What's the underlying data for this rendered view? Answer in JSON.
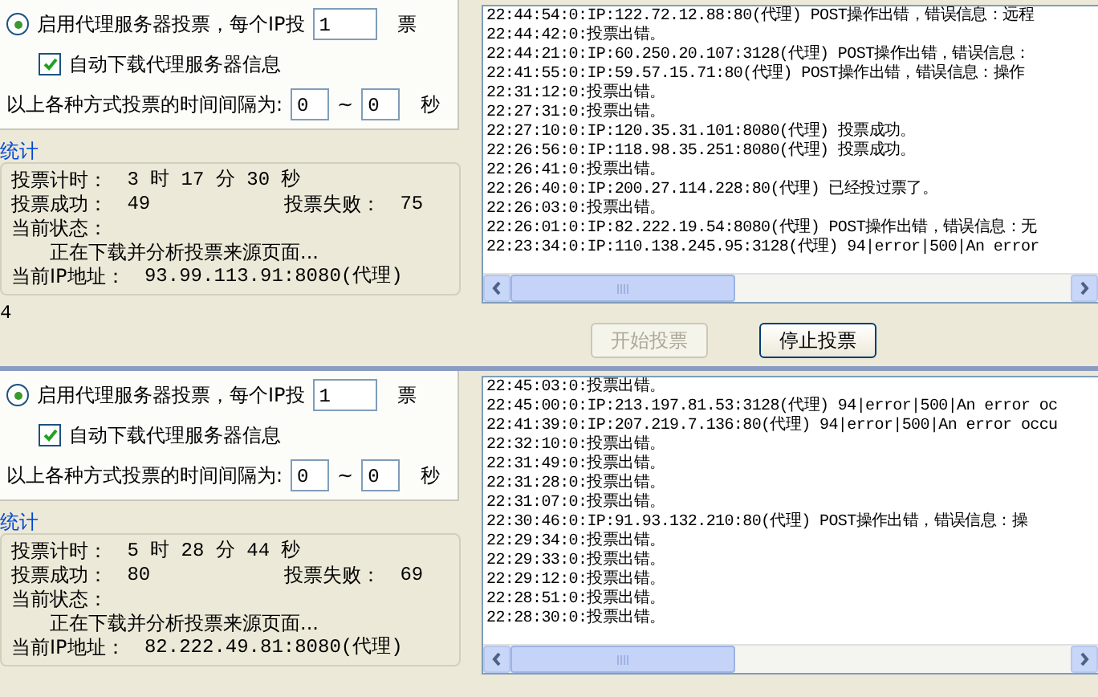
{
  "panels": [
    {
      "proxy_option": {
        "label": "启用代理服务器投票，每个IP投",
        "selected": true,
        "value": "1",
        "unit": "票"
      },
      "auto_download": {
        "label": "自动下载代理服务器信息",
        "checked": true
      },
      "interval": {
        "label": "以上各种方式投票的时间间隔为:",
        "from": "0",
        "separator": "~",
        "to": "0",
        "unit": "秒"
      },
      "stats": {
        "title": "统计",
        "timer_label": "投票计时：",
        "timer": "3 时 17 分 30 秒",
        "success_label": "投票成功：",
        "success": "49",
        "fail_label": "投票失败：",
        "fail": "75",
        "status_label": "当前状态：",
        "status": "正在下载并分析投票来源页面...",
        "ip_label": "当前IP地址：",
        "ip": "93.99.113.91:8080(代理)"
      },
      "footer": "4",
      "log": [
        "22:44:54:0:IP:122.72.12.88:80(代理) POST操作出错，错误信息：远程",
        "22:44:42:0:投票出错。",
        "22:44:21:0:IP:60.250.20.107:3128(代理) POST操作出错，错误信息：",
        "22:41:55:0:IP:59.57.15.71:80(代理) POST操作出错，错误信息：操作",
        "22:31:12:0:投票出错。",
        "22:27:31:0:投票出错。",
        "22:27:10:0:IP:120.35.31.101:8080(代理) 投票成功。",
        "22:26:56:0:IP:118.98.35.251:8080(代理) 投票成功。",
        "22:26:41:0:投票出错。",
        "22:26:40:0:IP:200.27.114.228:80(代理) 已经投过票了。",
        "22:26:03:0:投票出错。",
        "22:26:01:0:IP:82.222.19.54:8080(代理) POST操作出错，错误信息：无",
        "22:23:34:0:IP:110.138.245.95:3128(代理) 94|error|500|An error"
      ],
      "buttons": [
        {
          "label": "开始投票",
          "disabled": true
        },
        {
          "label": "停止投票",
          "disabled": false
        }
      ]
    },
    {
      "proxy_option": {
        "label": "启用代理服务器投票，每个IP投",
        "selected": true,
        "value": "1",
        "unit": "票"
      },
      "auto_download": {
        "label": "自动下载代理服务器信息",
        "checked": true
      },
      "interval": {
        "label": "以上各种方式投票的时间间隔为:",
        "from": "0",
        "separator": "~",
        "to": "0",
        "unit": "秒"
      },
      "stats": {
        "title": "统计",
        "timer_label": "投票计时：",
        "timer": "5 时 28 分 44 秒",
        "success_label": "投票成功：",
        "success": "80",
        "fail_label": "投票失败：",
        "fail": "69",
        "status_label": "当前状态：",
        "status": "正在下载并分析投票来源页面...",
        "ip_label": "当前IP地址：",
        "ip": "82.222.49.81:8080(代理)"
      },
      "log": [
        "22:45:03:0:投票出错。",
        "22:45:00:0:IP:213.197.81.53:3128(代理) 94|error|500|An error oc",
        "22:41:39:0:IP:207.219.7.136:80(代理) 94|error|500|An error occu",
        "22:32:10:0:投票出错。",
        "22:31:49:0:投票出错。",
        "22:31:28:0:投票出错。",
        "22:31:07:0:投票出错。",
        "22:30:46:0:IP:91.93.132.210:80(代理) POST操作出错，错误信息：操",
        "22:29:34:0:投票出错。",
        "22:29:33:0:投票出错。",
        "22:29:12:0:投票出错。",
        "22:28:51:0:投票出错。",
        "22:28:30:0:投票出错。"
      ]
    }
  ]
}
